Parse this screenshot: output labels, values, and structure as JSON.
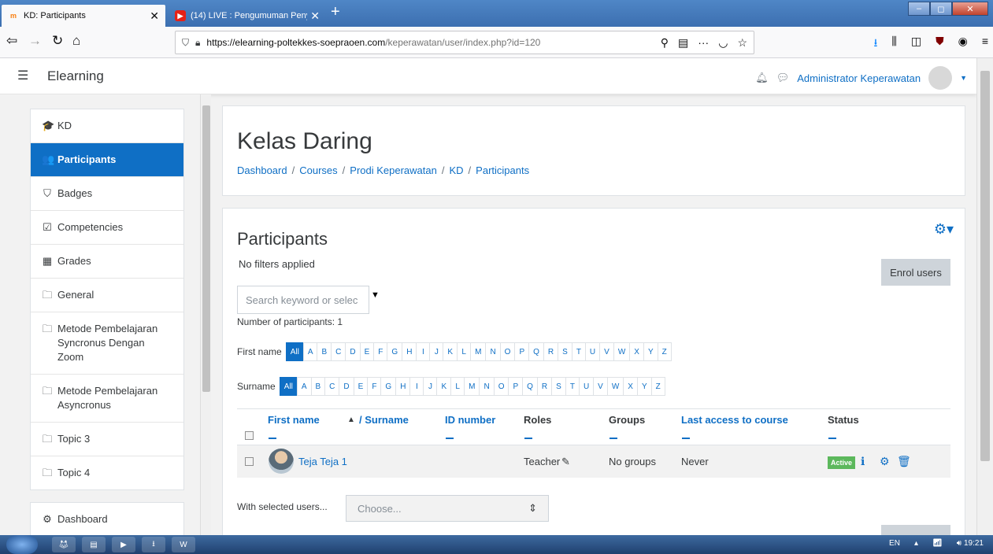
{
  "browser": {
    "tabs": [
      {
        "title": "KD: Participants",
        "favicon": "moodle-icon",
        "active": true
      },
      {
        "title": "(14) LIVE : Pengumuman Penye",
        "favicon": "youtube-icon",
        "active": false
      }
    ],
    "url_host": "https://elearning-poltekkes-soepraoen.com",
    "url_path": "/keperawatan/user/index.php?id=120"
  },
  "header": {
    "brand": "Elearning",
    "user_name": "Administrator Keperawatan"
  },
  "sidebar": {
    "items": [
      {
        "label": "KD",
        "icon": "graduation-cap-icon",
        "glyph": "🎓"
      },
      {
        "label": "Participants",
        "icon": "users-icon",
        "glyph": "👥",
        "active": true
      },
      {
        "label": "Badges",
        "icon": "shield-icon",
        "glyph": "⛉"
      },
      {
        "label": "Competencies",
        "icon": "check-square-icon",
        "glyph": "☑"
      },
      {
        "label": "Grades",
        "icon": "table-icon",
        "glyph": "▦"
      },
      {
        "label": "General",
        "icon": "folder-icon",
        "glyph": "🗀"
      },
      {
        "label": "Metode Pembelajaran Syncronus Dengan Zoom",
        "icon": "folder-icon",
        "glyph": "🗀"
      },
      {
        "label": "Metode Pembelajaran Asyncronus",
        "icon": "folder-icon",
        "glyph": "🗀"
      },
      {
        "label": "Topic 3",
        "icon": "folder-icon",
        "glyph": "🗀"
      },
      {
        "label": "Topic 4",
        "icon": "folder-icon",
        "glyph": "🗀"
      }
    ],
    "dashboard": "Dashboard"
  },
  "course": {
    "title": "Kelas Daring",
    "breadcrumb": [
      "Dashboard",
      "Courses",
      "Prodi Keperawatan",
      "KD",
      "Participants"
    ]
  },
  "participants": {
    "heading": "Participants",
    "filters": "No filters applied",
    "enrol_label": "Enrol users",
    "search_placeholder": "Search keyword or selec",
    "count_text": "Number of participants: 1",
    "firstname_label": "First name",
    "surname_label": "Surname",
    "all_label": "All",
    "letters": [
      "A",
      "B",
      "C",
      "D",
      "E",
      "F",
      "G",
      "H",
      "I",
      "J",
      "K",
      "L",
      "M",
      "N",
      "O",
      "P",
      "Q",
      "R",
      "S",
      "T",
      "U",
      "V",
      "W",
      "X",
      "Y",
      "Z"
    ],
    "columns": {
      "first_name": "First name",
      "surname": "/ Surname",
      "id_number": "ID number",
      "roles": "Roles",
      "groups": "Groups",
      "last_access": "Last access to course",
      "status": "Status"
    },
    "rows": [
      {
        "name": "Teja Teja 1",
        "role": "Teacher",
        "groups": "No groups",
        "last_access": "Never",
        "status": "Active"
      }
    ],
    "with_selected": "With selected users...",
    "choose": "Choose..."
  },
  "taskbar": {
    "lang": "EN",
    "time": "19:21"
  }
}
